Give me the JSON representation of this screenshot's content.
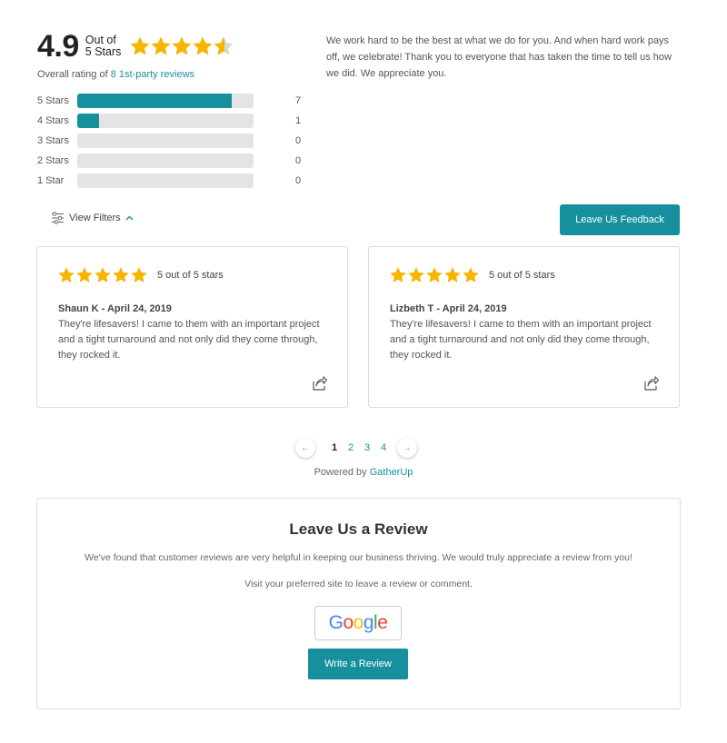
{
  "summary": {
    "score": "4.9",
    "out_of": "Out of 5 Stars",
    "overall_prefix": "Overall rating of ",
    "overall_link": "8 1st-party reviews",
    "rating_value": 4.9,
    "star_color": "#f7b500",
    "empty_star_color": "#d8d8d8"
  },
  "breakdown": [
    {
      "label": "5 Stars",
      "count": "7",
      "fraction": 0.875
    },
    {
      "label": "4 Stars",
      "count": "1",
      "fraction": 0.125
    },
    {
      "label": "3 Stars",
      "count": "0",
      "fraction": 0
    },
    {
      "label": "2 Stars",
      "count": "0",
      "fraction": 0
    },
    {
      "label": "1 Star",
      "count": "0",
      "fraction": 0
    }
  ],
  "intro_text": "We work hard to be the best at what we do for you. And when hard work pays off, we celebrate! Thank you to everyone that has taken the time to tell us how we did. We appreciate you.",
  "controls": {
    "filters_label": "View Filters",
    "filters_icon": "sliders-icon",
    "feedback_button": "Leave Us Feedback"
  },
  "reviews": [
    {
      "stars": 5,
      "rating_text": "5 out of 5 stars",
      "author_date": "Shaun K - April 24, 2019",
      "body": "They're lifesavers! I came to them with an important project and a tight turnaround and not only did they come through, they rocked it."
    },
    {
      "stars": 5,
      "rating_text": "5 out of 5 stars",
      "author_date": "Lizbeth T - April 24, 2019",
      "body": "They're lifesavers! I came to them with an important project and a tight turnaround and not only did they come through, they rocked it."
    }
  ],
  "pagination": {
    "prev": "←",
    "next": "→",
    "pages": [
      "1",
      "2",
      "3",
      "4"
    ],
    "current": "1"
  },
  "powered_by": {
    "prefix": "Powered by ",
    "link": "GatherUp"
  },
  "leave_review": {
    "title": "Leave Us a Review",
    "text1": "We've found that customer reviews are very helpful in keeping our business thriving. We would truly appreciate a review from you!",
    "text2": "Visit your preferred site to leave a review or comment.",
    "google_label": "Google",
    "write_button": "Write a Review"
  },
  "colors": {
    "accent": "#17909e",
    "google_blue": "#4285F4",
    "google_red": "#EA4335",
    "google_yellow": "#FBBC05",
    "google_green": "#34A853"
  }
}
